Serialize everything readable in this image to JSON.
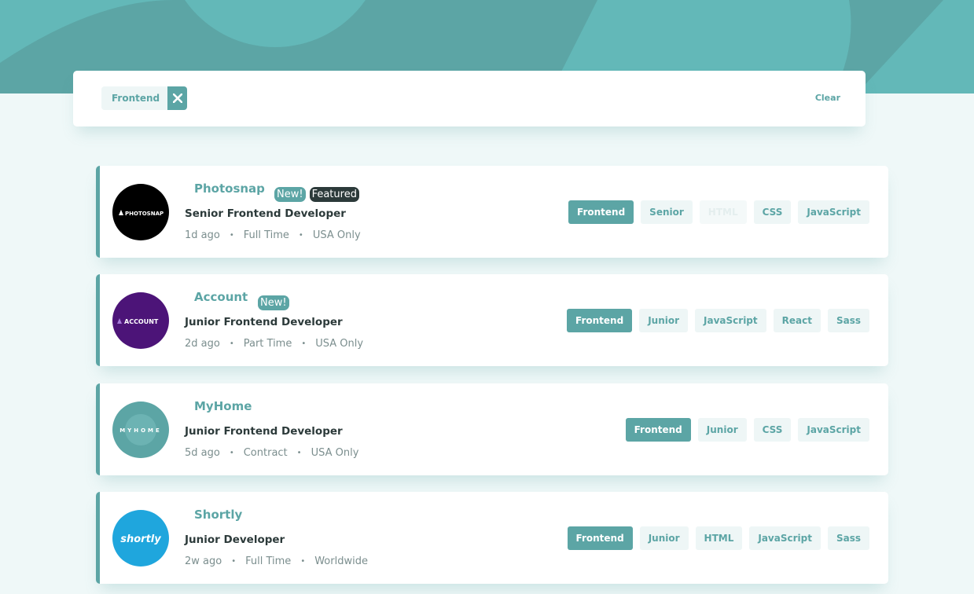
{
  "filter_bar": {
    "filters": [
      {
        "label": "Frontend"
      }
    ],
    "clear_label": "Clear"
  },
  "jobs": [
    {
      "company": "Photosnap",
      "logo_text": "PHOTOSNAP",
      "logo_color": "#000000",
      "is_new": true,
      "is_featured": true,
      "new_label": "New!",
      "featured_label": "Featured",
      "position": "Senior Frontend Developer",
      "posted": "1d ago",
      "contract": "Full Time",
      "location": "USA Only",
      "tags": [
        "Frontend",
        "Senior",
        "HTML",
        "CSS",
        "JavaScript"
      ]
    },
    {
      "company": "Account",
      "logo_text": "ACCOUNT",
      "logo_color": "#4c1478",
      "is_new": true,
      "is_featured": false,
      "new_label": "New!",
      "position": "Junior Frontend Developer",
      "posted": "2d ago",
      "contract": "Part Time",
      "location": "USA Only",
      "tags": [
        "Frontend",
        "Junior",
        "JavaScript",
        "React",
        "Sass"
      ]
    },
    {
      "company": "MyHome",
      "logo_text": "MYHOME",
      "logo_color": "#5ca5a5",
      "is_new": false,
      "is_featured": false,
      "position": "Junior Frontend Developer",
      "posted": "5d ago",
      "contract": "Contract",
      "location": "USA Only",
      "tags": [
        "Frontend",
        "Junior",
        "CSS",
        "JavaScript"
      ]
    },
    {
      "company": "Shortly",
      "logo_text": "shortly",
      "logo_color": "#1fa6dd",
      "is_new": false,
      "is_featured": false,
      "position": "Junior Developer",
      "posted": "2w ago",
      "contract": "Full Time",
      "location": "Worldwide",
      "tags": [
        "Frontend",
        "Junior",
        "HTML",
        "JavaScript",
        "Sass"
      ]
    }
  ],
  "colors": {
    "primary": "#5ca5a5",
    "background": "#eff8f8",
    "dark": "#2c3a3a",
    "muted": "#7b8e8e",
    "tag_background": "#eef6f6"
  },
  "icons": {
    "remove_filter": "close-icon",
    "meta_separator": "dot-icon"
  }
}
